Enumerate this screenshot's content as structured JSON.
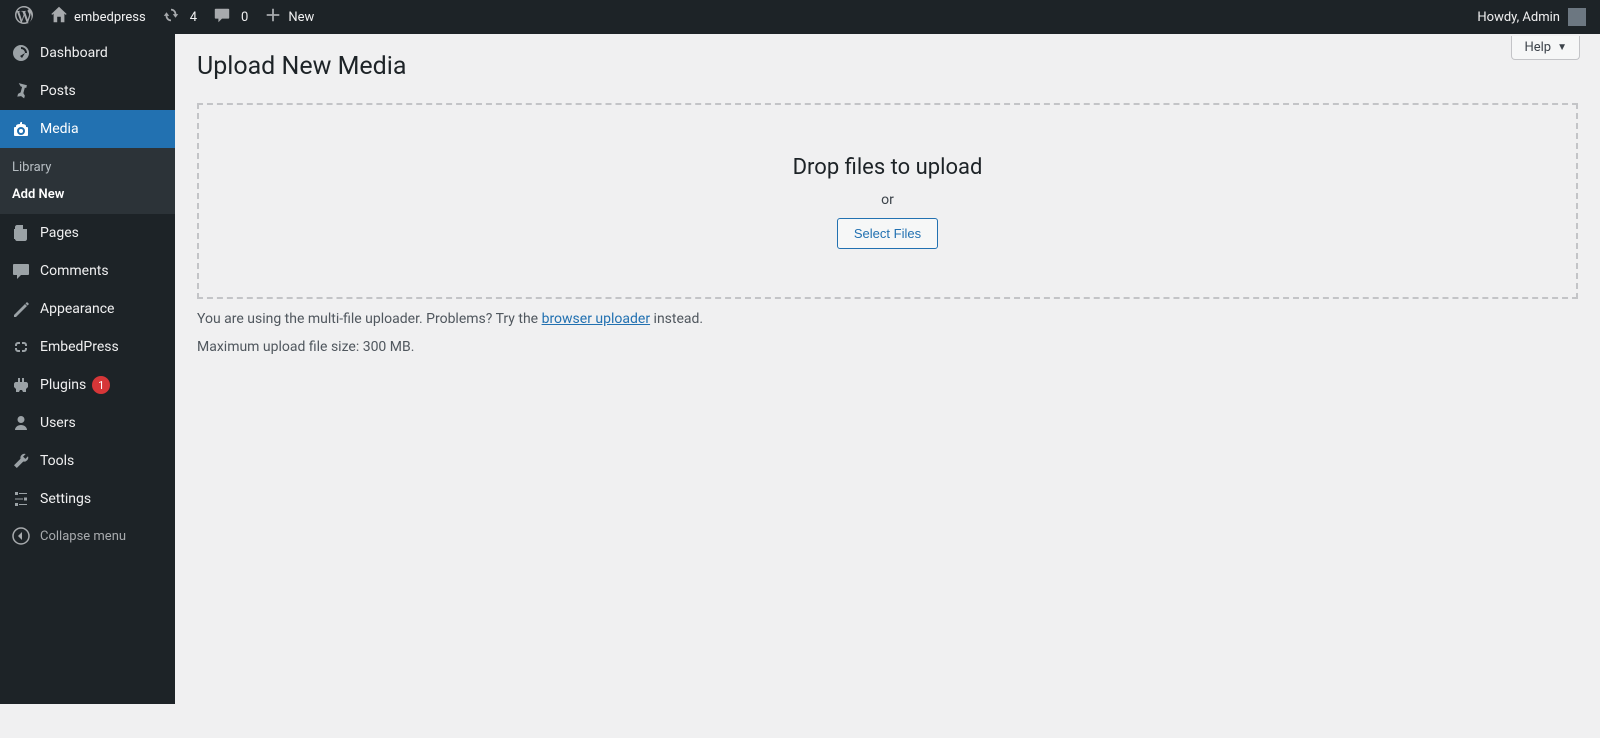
{
  "adminbar": {
    "site_name": "embedpress",
    "updates_count": "4",
    "comments_count": "0",
    "new_label": "New",
    "howdy": "Howdy, Admin"
  },
  "sidebar": {
    "dashboard": "Dashboard",
    "posts": "Posts",
    "media": "Media",
    "media_sub": {
      "library": "Library",
      "add_new": "Add New"
    },
    "pages": "Pages",
    "comments": "Comments",
    "appearance": "Appearance",
    "embedpress": "EmbedPress",
    "plugins": "Plugins",
    "plugins_badge": "1",
    "users": "Users",
    "tools": "Tools",
    "settings": "Settings",
    "collapse": "Collapse menu"
  },
  "screen": {
    "help_label": "Help",
    "title": "Upload New Media",
    "dropzone": {
      "drop_text": "Drop files to upload",
      "or_text": "or",
      "button_label": "Select Files"
    },
    "note_prefix": "You are using the multi-file uploader. Problems? Try the ",
    "note_link": "browser uploader",
    "note_suffix": " instead.",
    "max_size": "Maximum upload file size: 300 MB."
  }
}
